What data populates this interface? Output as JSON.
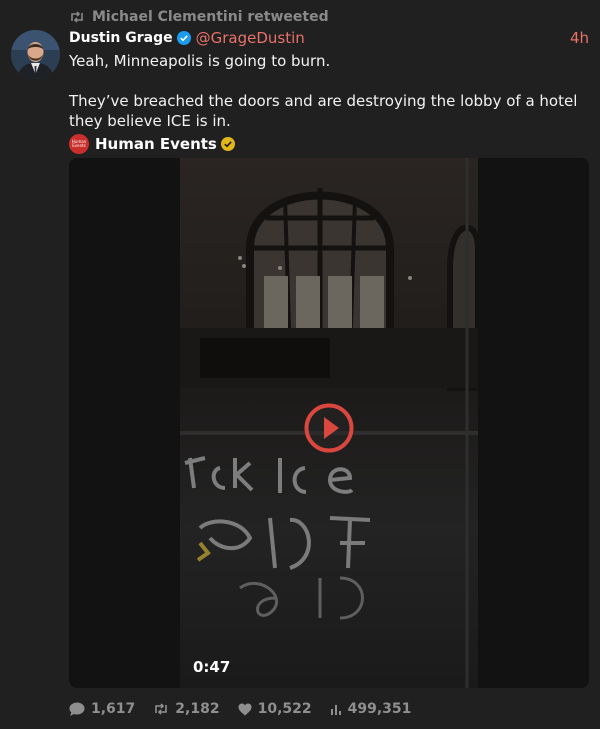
{
  "retweet": {
    "icon": "retweet-icon",
    "text": "Michael Clementini retweeted"
  },
  "tweet": {
    "author_name": "Dustin Grage",
    "author_verified": true,
    "handle": "@GrageDustin",
    "timestamp": "4h",
    "text_paragraphs": [
      "Yeah, Minneapolis is going to burn.",
      "They’ve breached the doors and are destroying the lobby of a hotel they believe ICE is in."
    ]
  },
  "source": {
    "logo_text": "Human Events",
    "name": "Human Events",
    "badge": "gold-verified-icon"
  },
  "media": {
    "type": "video",
    "duration": "0:47",
    "overlay_icon": "play-icon"
  },
  "stats": {
    "replies": "1,617",
    "retweets": "2,182",
    "likes": "10,522",
    "views": "499,351"
  },
  "colors": {
    "background": "#202020",
    "accent": "#e8716a",
    "muted": "#8a8a8a",
    "verified_blue": "#1d9bf0",
    "verified_gold": "#e2b719",
    "play_red": "#d9473f"
  }
}
